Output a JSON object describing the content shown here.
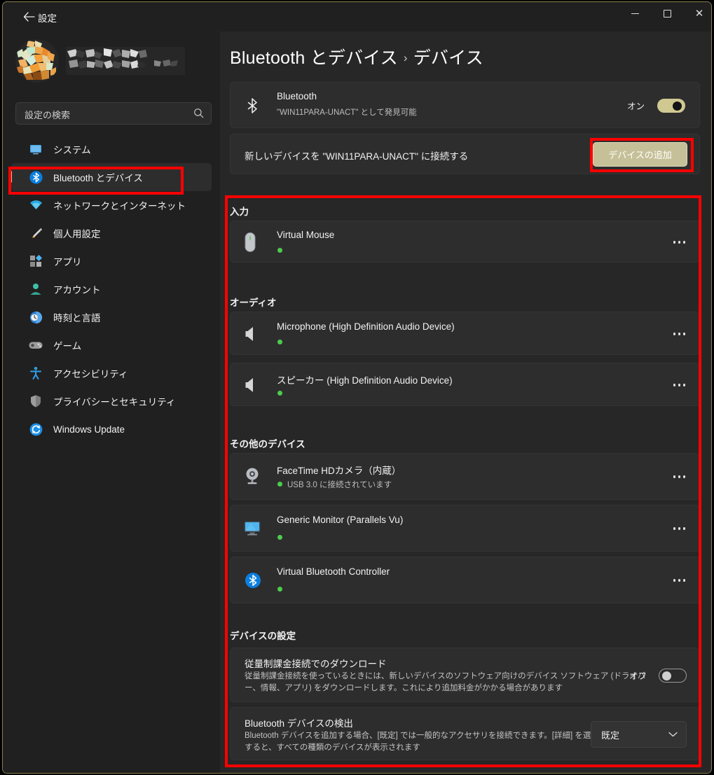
{
  "window": {
    "title": "設定",
    "back_icon": "arrow-left-icon",
    "controls": {
      "minimize": "minimize-icon",
      "maximize": "maximize-icon",
      "close": "close-icon"
    },
    "border_color": "#8a7f4e"
  },
  "sidebar": {
    "account": {
      "avatar": "user-avatar-mosaic",
      "name_redacted": ""
    },
    "search": {
      "placeholder": "設定の検索",
      "icon": "search-icon"
    },
    "items": [
      {
        "label": "システム",
        "icon": "system-icon",
        "selected": false
      },
      {
        "label": "Bluetooth とデバイス",
        "icon": "bluetooth-icon",
        "selected": true
      },
      {
        "label": "ネットワークとインターネット",
        "icon": "network-icon",
        "selected": false
      },
      {
        "label": "個人用設定",
        "icon": "personalization-brush-icon",
        "selected": false
      },
      {
        "label": "アプリ",
        "icon": "apps-icon",
        "selected": false
      },
      {
        "label": "アカウント",
        "icon": "account-icon",
        "selected": false
      },
      {
        "label": "時刻と言語",
        "icon": "time-language-clock-icon",
        "selected": false
      },
      {
        "label": "ゲーム",
        "icon": "gaming-controller-icon",
        "selected": false
      },
      {
        "label": "アクセシビリティ",
        "icon": "accessibility-icon",
        "selected": false
      },
      {
        "label": "プライバシーとセキュリティ",
        "icon": "shield-icon",
        "selected": false
      },
      {
        "label": "Windows Update",
        "icon": "update-icon",
        "selected": false
      }
    ]
  },
  "main": {
    "breadcrumb": {
      "root": "Bluetooth とデバイス",
      "separator": "›",
      "current": "デバイス"
    },
    "bluetooth_card": {
      "icon": "bluetooth-icon",
      "title": "Bluetooth",
      "subtitle": "\"WIN11PARA-UNACT\" として発見可能",
      "toggle_label": "オン",
      "toggle_state": "on"
    },
    "add_device_card": {
      "text": "新しいデバイスを \"WIN11PARA-UNACT\" に接続する",
      "button_label": "デバイスの追加",
      "button_color": "#c6c098"
    },
    "sections": [
      {
        "label": "入力",
        "devices": [
          {
            "name": "Virtual Mouse",
            "status": "",
            "icon": "mouse-icon",
            "connected": true,
            "menu": "more-options-icon"
          }
        ]
      },
      {
        "label": "オーディオ",
        "devices": [
          {
            "name": "Microphone (High Definition Audio Device)",
            "status": "",
            "icon": "speaker-icon",
            "connected": true,
            "menu": "more-options-icon"
          },
          {
            "name": "スピーカー (High Definition Audio Device)",
            "status": "",
            "icon": "speaker-icon",
            "connected": true,
            "menu": "more-options-icon"
          }
        ]
      },
      {
        "label": "その他のデバイス",
        "devices": [
          {
            "name": "FaceTime HDカメラ（内蔵）",
            "status": "USB 3.0 に接続されています",
            "icon": "webcam-icon",
            "connected": true,
            "menu": "more-options-icon"
          },
          {
            "name": "Generic Monitor (Parallels Vu)",
            "status": "",
            "icon": "monitor-icon",
            "connected": true,
            "menu": "more-options-icon"
          },
          {
            "name": "Virtual Bluetooth Controller",
            "status": "",
            "icon": "bluetooth-icon",
            "connected": true,
            "menu": "more-options-icon"
          }
        ]
      }
    ],
    "device_settings": {
      "label": "デバイスの設定",
      "metered": {
        "title": "従量制課金接続でのダウンロード",
        "description": "従量制課金接続を使っているときには、新しいデバイスのソフトウェア向けのデバイス ソフトウェア (ドライバー、情報、アプリ) をダウンロードします。これにより追加料金がかかる場合があります",
        "toggle_label": "オフ",
        "toggle_state": "off"
      },
      "discovery": {
        "title": "Bluetooth デバイスの検出",
        "description": "Bluetooth デバイスを追加する場合、[既定] では一般的なアクセサリを接続できます。[詳細] を選択すると、すべての種類のデバイスが表示されます",
        "selected_option": "既定",
        "chevron": "chevron-down-icon"
      }
    }
  },
  "annotations": {
    "color": "#ff0000",
    "boxes": [
      "sidebar-bluetooth-item",
      "add-device-button",
      "devices-content-area"
    ]
  }
}
